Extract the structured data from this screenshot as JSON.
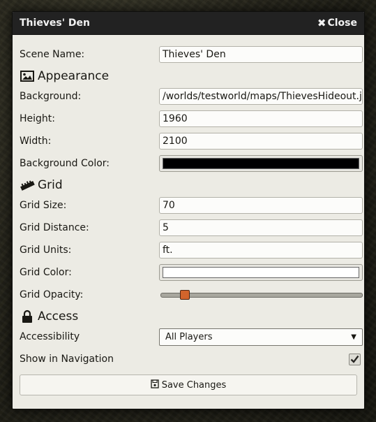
{
  "window": {
    "title": "Thieves' Den",
    "close_label": "Close"
  },
  "fields": {
    "scene_name": {
      "label": "Scene Name:",
      "value": "Thieves' Den"
    },
    "background": {
      "label": "Background:",
      "value": "/worlds/testworld/maps/ThievesHideout.jpg"
    },
    "height": {
      "label": "Height:",
      "value": "1960"
    },
    "width": {
      "label": "Width:",
      "value": "2100"
    },
    "background_color": {
      "label": "Background Color:",
      "value": "#000000"
    },
    "grid_size": {
      "label": "Grid Size:",
      "value": "70"
    },
    "grid_distance": {
      "label": "Grid Distance:",
      "value": "5"
    },
    "grid_units": {
      "label": "Grid Units:",
      "value": "ft."
    },
    "grid_color": {
      "label": "Grid Color:",
      "value": "#ffffff"
    },
    "grid_opacity": {
      "label": "Grid Opacity:",
      "value": 0.12
    },
    "accessibility": {
      "label": "Accessibility",
      "value": "All Players"
    },
    "show_in_navigation": {
      "label": "Show in Navigation",
      "checked": true
    }
  },
  "sections": {
    "appearance": {
      "label": "Appearance",
      "icon": "image-icon"
    },
    "grid": {
      "label": "Grid",
      "icon": "ruler-icon"
    },
    "access": {
      "label": "Access",
      "icon": "lock-icon"
    }
  },
  "save_button": {
    "label": "Save Changes",
    "icon": "save-icon"
  },
  "colors": {
    "titlebar": "#222222",
    "panel": "#ecebe4",
    "slider_thumb": "#d2642c"
  }
}
